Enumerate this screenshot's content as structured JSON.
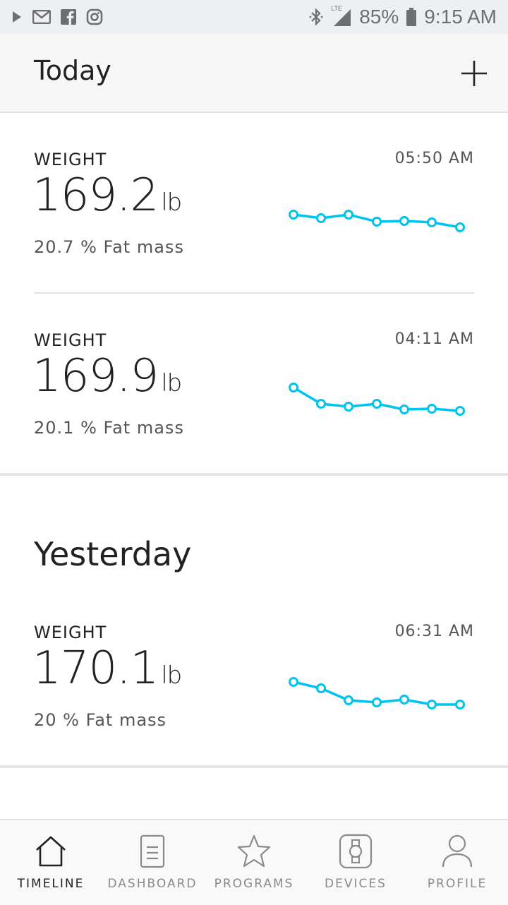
{
  "status_bar": {
    "left_icons": [
      "play-store-icon",
      "gmail-icon",
      "facebook-icon",
      "instagram-icon"
    ],
    "right_icons": [
      "bluetooth-icon",
      "lte-signal-icon",
      "battery-icon"
    ],
    "lte": "LTE",
    "battery": "85%",
    "time": "9:15 AM"
  },
  "header": {
    "title": "Today",
    "add_icon": "plus-icon"
  },
  "sections": {
    "yesterday_title": "Yesterday"
  },
  "entries": [
    {
      "label": "WEIGHT",
      "time": "05:50 AM",
      "value": "169.2",
      "unit": "lb",
      "sub": "20.7 % Fat mass"
    },
    {
      "label": "WEIGHT",
      "time": "04:11 AM",
      "value": "169.9",
      "unit": "lb",
      "sub": "20.1 % Fat mass"
    },
    {
      "label": "WEIGHT",
      "time": "06:31 AM",
      "value": "170.1",
      "unit": "lb",
      "sub": "20 % Fat mass"
    }
  ],
  "sparkline_color": "#00c4f0",
  "bottom_nav": [
    {
      "label": "TIMELINE",
      "icon": "home-icon",
      "active": true
    },
    {
      "label": "DASHBOARD",
      "icon": "document-icon",
      "active": false
    },
    {
      "label": "PROGRAMS",
      "icon": "star-icon",
      "active": false
    },
    {
      "label": "DEVICES",
      "icon": "watch-icon",
      "active": false
    },
    {
      "label": "PROFILE",
      "icon": "person-icon",
      "active": false
    }
  ]
}
